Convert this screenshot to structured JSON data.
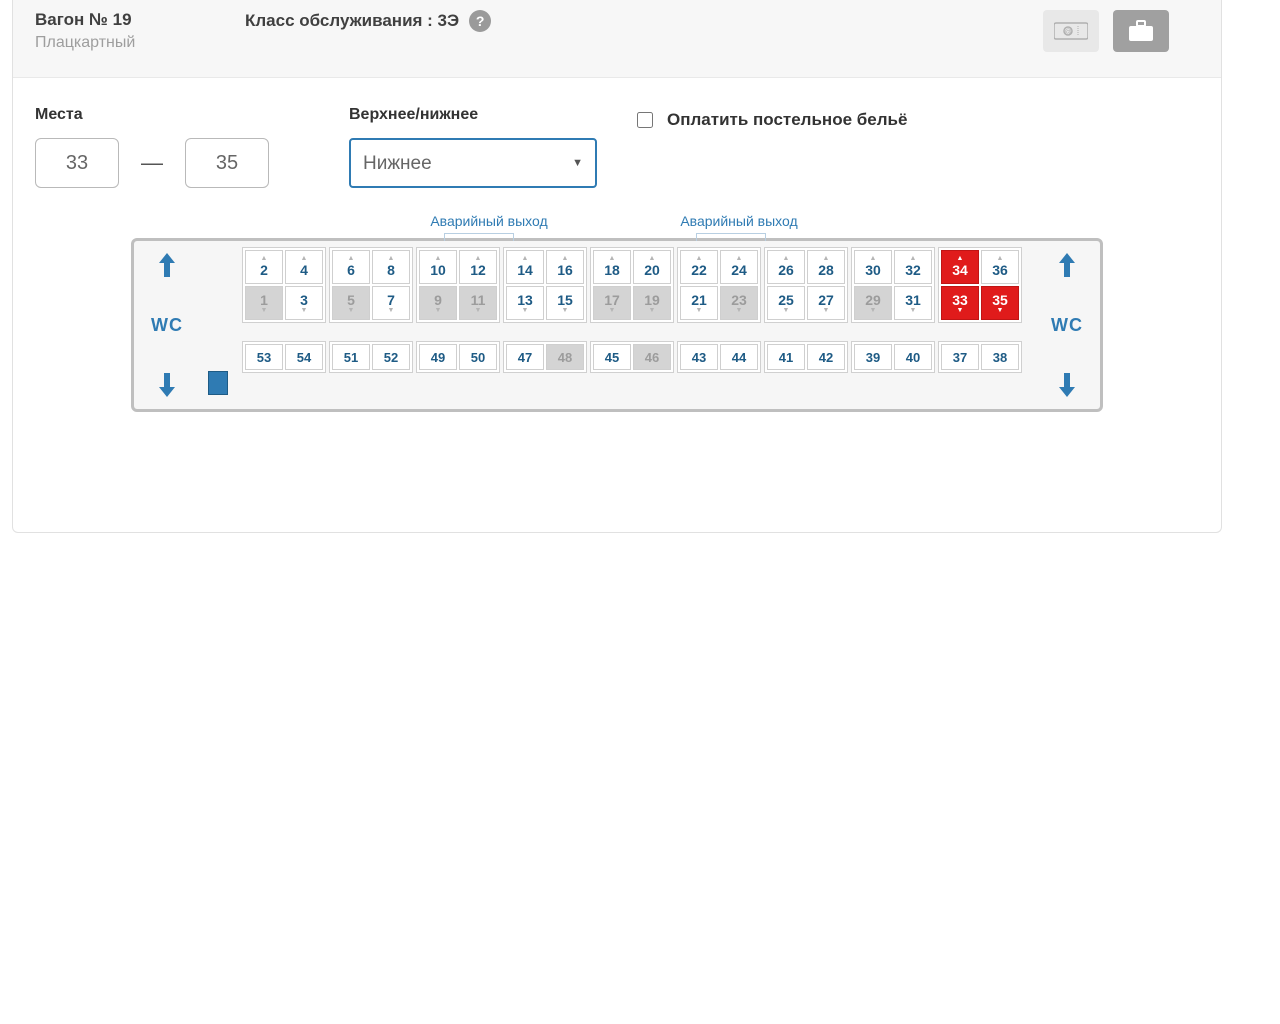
{
  "header": {
    "wagon_title": "Вагон № 19",
    "wagon_type": "Плацкартный",
    "class_label": "Класс обслуживания : 3Э",
    "help": "?"
  },
  "form": {
    "seats_label": "Места",
    "seat_from": "33",
    "seat_to": "35",
    "dash": "—",
    "level_label": "Верхнее/нижнее",
    "level_value": "Нижнее",
    "linen_label": "Оплатить постельное бельё",
    "linen_checked": false
  },
  "map": {
    "exit_label": "Аварийный выход",
    "wc_label": "WC",
    "compartments": [
      {
        "upper": [
          {
            "n": 2,
            "state": "avail"
          },
          {
            "n": 4,
            "state": "avail"
          }
        ],
        "lower": [
          {
            "n": 1,
            "state": "occ"
          },
          {
            "n": 3,
            "state": "avail"
          }
        ]
      },
      {
        "upper": [
          {
            "n": 6,
            "state": "avail"
          },
          {
            "n": 8,
            "state": "avail"
          }
        ],
        "lower": [
          {
            "n": 5,
            "state": "occ"
          },
          {
            "n": 7,
            "state": "avail"
          }
        ]
      },
      {
        "upper": [
          {
            "n": 10,
            "state": "avail"
          },
          {
            "n": 12,
            "state": "avail"
          }
        ],
        "lower": [
          {
            "n": 9,
            "state": "occ"
          },
          {
            "n": 11,
            "state": "occ"
          }
        ]
      },
      {
        "upper": [
          {
            "n": 14,
            "state": "avail"
          },
          {
            "n": 16,
            "state": "avail"
          }
        ],
        "lower": [
          {
            "n": 13,
            "state": "avail"
          },
          {
            "n": 15,
            "state": "avail"
          }
        ]
      },
      {
        "upper": [
          {
            "n": 18,
            "state": "avail"
          },
          {
            "n": 20,
            "state": "avail"
          }
        ],
        "lower": [
          {
            "n": 17,
            "state": "occ"
          },
          {
            "n": 19,
            "state": "occ"
          }
        ]
      },
      {
        "upper": [
          {
            "n": 22,
            "state": "avail"
          },
          {
            "n": 24,
            "state": "avail"
          }
        ],
        "lower": [
          {
            "n": 21,
            "state": "avail"
          },
          {
            "n": 23,
            "state": "occ"
          }
        ]
      },
      {
        "upper": [
          {
            "n": 26,
            "state": "avail"
          },
          {
            "n": 28,
            "state": "avail"
          }
        ],
        "lower": [
          {
            "n": 25,
            "state": "avail"
          },
          {
            "n": 27,
            "state": "avail"
          }
        ]
      },
      {
        "upper": [
          {
            "n": 30,
            "state": "avail"
          },
          {
            "n": 32,
            "state": "avail"
          }
        ],
        "lower": [
          {
            "n": 29,
            "state": "occ"
          },
          {
            "n": 31,
            "state": "avail"
          }
        ]
      },
      {
        "upper": [
          {
            "n": 34,
            "state": "sel"
          },
          {
            "n": 36,
            "state": "avail"
          }
        ],
        "lower": [
          {
            "n": 33,
            "state": "sel"
          },
          {
            "n": 35,
            "state": "sel"
          }
        ]
      }
    ],
    "side_seats": [
      [
        {
          "n": 53,
          "state": "avail"
        },
        {
          "n": 54,
          "state": "avail"
        }
      ],
      [
        {
          "n": 51,
          "state": "avail"
        },
        {
          "n": 52,
          "state": "avail"
        }
      ],
      [
        {
          "n": 49,
          "state": "avail"
        },
        {
          "n": 50,
          "state": "avail"
        }
      ],
      [
        {
          "n": 47,
          "state": "avail"
        },
        {
          "n": 48,
          "state": "occ"
        }
      ],
      [
        {
          "n": 45,
          "state": "avail"
        },
        {
          "n": 46,
          "state": "occ"
        }
      ],
      [
        {
          "n": 43,
          "state": "avail"
        },
        {
          "n": 44,
          "state": "avail"
        }
      ],
      [
        {
          "n": 41,
          "state": "avail"
        },
        {
          "n": 42,
          "state": "avail"
        }
      ],
      [
        {
          "n": 39,
          "state": "avail"
        },
        {
          "n": 40,
          "state": "avail"
        }
      ],
      [
        {
          "n": 37,
          "state": "avail"
        },
        {
          "n": 38,
          "state": "avail"
        }
      ]
    ]
  }
}
